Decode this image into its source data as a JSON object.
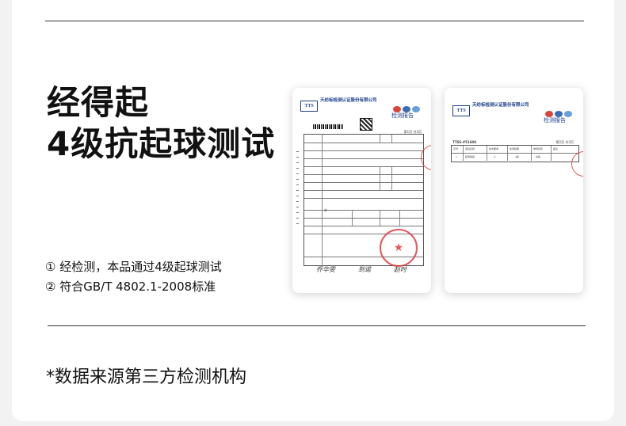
{
  "headline": {
    "line1": "经得起",
    "line2": "4级抗起球测试"
  },
  "notes": [
    {
      "marker": "①",
      "text": " 经检测，本品通过4级起球测试"
    },
    {
      "marker": "②",
      "text": " 符合GB/T 4802.1-2008标准"
    }
  ],
  "footnote": "*数据来源第三方检测机构",
  "report1": {
    "logo": "TTS",
    "org": "天纺标检测认证股份有限公司",
    "title": "检测报告",
    "page_no": "第1页 共3页",
    "sample_name": "亦",
    "signatures": [
      "乔华雯",
      "到诺",
      "赵时"
    ]
  },
  "report2": {
    "logo": "TTS",
    "org": "天纺标检测认证股份有限公司",
    "title": "检测报告",
    "page_no": "第2页 共3页",
    "report_id": "TTSS-#51608",
    "row1": [
      "序号",
      "项目名称",
      "技术要求",
      "检测结果",
      "单项判定",
      "备注"
    ],
    "row2": [
      "1",
      "起球等级",
      "≥",
      "4级",
      "合格",
      ""
    ]
  },
  "colors": {
    "accent": "#1d3f8a",
    "seal": "#e03b3b",
    "rule": "#333333"
  }
}
